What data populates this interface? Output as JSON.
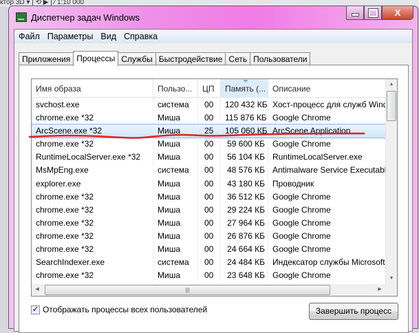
{
  "background_toolbar": "ктор 3D ▾    |   ⟲  ▶  |  ⁄  1:10 000",
  "window": {
    "title": "Диспетчер задач Windows",
    "controls": {
      "minimize": "",
      "maximize": "",
      "close": "X"
    }
  },
  "menu": [
    "Файл",
    "Параметры",
    "Вид",
    "Справка"
  ],
  "tabs": [
    {
      "label": "Приложения"
    },
    {
      "label": "Процессы",
      "active": true
    },
    {
      "label": "Службы"
    },
    {
      "label": "Быстродействие"
    },
    {
      "label": "Сеть"
    },
    {
      "label": "Пользователи"
    }
  ],
  "columns": [
    "Имя образа",
    "Пользо...",
    "ЦП",
    "Память (...",
    "Описание"
  ],
  "sorted_column": "Память (...",
  "rows": [
    [
      "svchost.exe",
      "система",
      "00",
      "120 432 КБ",
      "Хост-процесс для служб Windows"
    ],
    [
      "chrome.exe *32",
      "Миша",
      "00",
      "115 876 КБ",
      "Google Chrome"
    ],
    [
      "ArcScene.exe *32",
      "Миша",
      "25",
      "105 060 КБ",
      "ArcScene Application"
    ],
    [
      "chrome.exe *32",
      "Миша",
      "00",
      "59 600 КБ",
      "Google Chrome"
    ],
    [
      "RuntimeLocalServer.exe *32",
      "Миша",
      "00",
      "56 104 КБ",
      "RuntimeLocalServer.exe"
    ],
    [
      "MsMpEng.exe",
      "система",
      "00",
      "48 576 КБ",
      "Antimalware Service Executable"
    ],
    [
      "explorer.exe",
      "Миша",
      "00",
      "43 180 КБ",
      "Проводник"
    ],
    [
      "chrome.exe *32",
      "Миша",
      "00",
      "36 512 КБ",
      "Google Chrome"
    ],
    [
      "chrome.exe *32",
      "Миша",
      "00",
      "29 224 КБ",
      "Google Chrome"
    ],
    [
      "chrome.exe *32",
      "Миша",
      "00",
      "27 964 КБ",
      "Google Chrome"
    ],
    [
      "chrome.exe *32",
      "Миша",
      "00",
      "26 876 КБ",
      "Google Chrome"
    ],
    [
      "chrome.exe *32",
      "Миша",
      "00",
      "24 664 КБ",
      "Google Chrome"
    ],
    [
      "SearchIndexer.exe",
      "система",
      "00",
      "24 484 КБ",
      "Индексатор службы Microsoft Windows"
    ],
    [
      "chrome.exe *32",
      "Миша",
      "00",
      "23 648 КБ",
      "Google Chrome"
    ]
  ],
  "selected_row": 2,
  "annotation_color": "#e0202a",
  "show_all_users": {
    "label": "Отображать процессы всех пользователей",
    "checked": true
  },
  "end_process_button": "Завершить процесс"
}
